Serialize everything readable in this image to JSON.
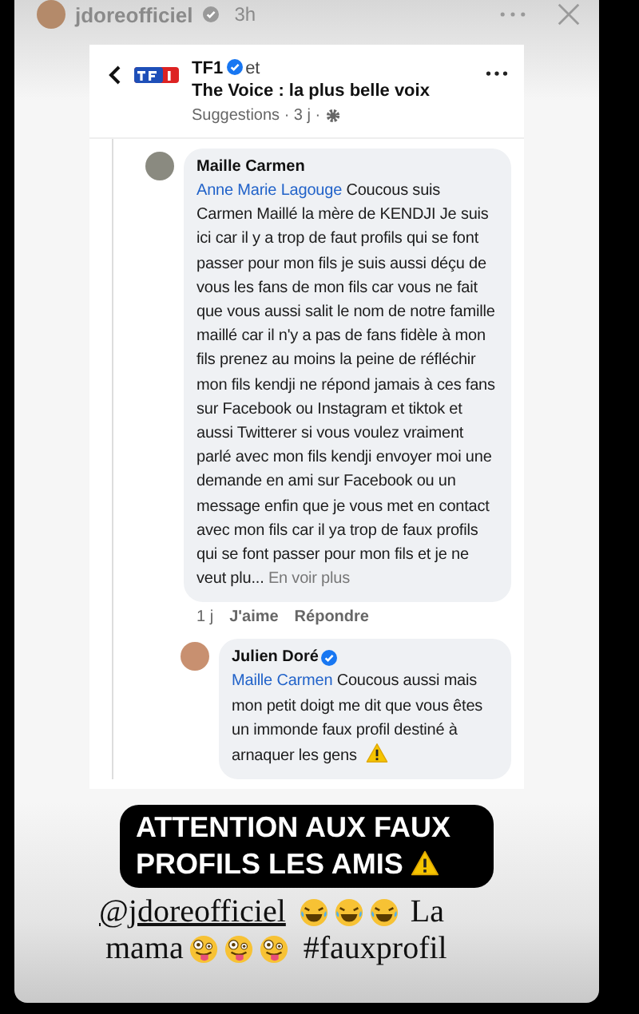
{
  "story": {
    "username": "jdoreofficiel",
    "verified": true,
    "time": "3h"
  },
  "post": {
    "page": "TF1",
    "verified": true,
    "connector": "et",
    "group": "The Voice : la plus belle voix",
    "meta": "Suggestions · 3 j ·"
  },
  "comments": [
    {
      "author": "Maille Carmen",
      "verified": false,
      "mention": "Anne Marie Lagouge",
      "text": "Coucous suis Carmen Maillé la mère de KENDJI Je suis ici car il y a trop de faut profils qui se font passer pour mon fils je suis aussi déçu de vous les fans de mon fils car vous ne fait que vous aussi salit  le nom de notre famille  maillé car il n'y a pas de fans fidèle à mon fils prenez au moins la peine de réfléchir mon fils kendji ne répond jamais à ces fans sur Facebook ou Instagram et tiktok et aussi Twitterer si vous voulez vraiment parlé avec mon fils kendji envoyer moi une demande en ami sur Facebook ou un message enfin que je vous met en contact avec mon fils car il ya trop de faux profils qui se font passer pour mon fils et je ne veut plu...",
      "more": "En voir plus",
      "age": "1 j",
      "like": "J'aime",
      "reply": "Répondre",
      "warning": false
    },
    {
      "author": "Julien Doré",
      "verified": true,
      "mention": "Maille Carmen",
      "text": "Coucous aussi mais mon petit doigt me dit que vous êtes un immonde faux profil destiné à arnaquer les gens",
      "warning": true
    }
  ],
  "sticker": {
    "text": "ATTENTION AUX FAUX PROFILS LES AMIS",
    "warning": true
  },
  "caption": {
    "mention": "@jdoreofficiel",
    "word_1": "La",
    "word_2": "mama",
    "hashtag": "#fauxprofil"
  }
}
